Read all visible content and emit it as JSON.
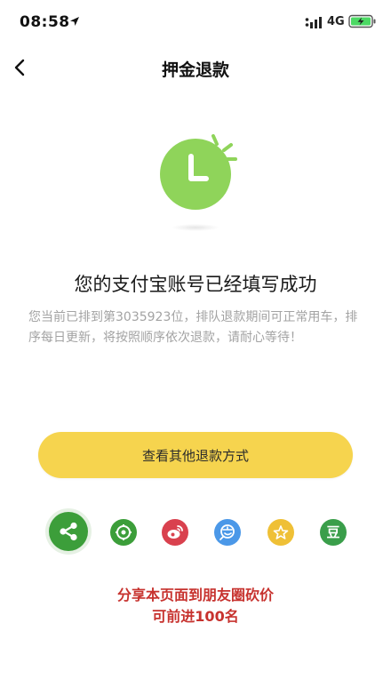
{
  "status_bar": {
    "time": "08:58",
    "network": "4G"
  },
  "nav": {
    "title": "押金退款"
  },
  "main": {
    "headline": "您的支付宝账号已经填写成功",
    "notice": "您当前已排到第3035923位，排队退款期间可正常用车，排序每日更新，将按照顺序依次退款，请耐心等待！",
    "primary_button": "查看其他退款方式"
  },
  "share": {
    "douban_glyph": "豆",
    "promo_line1": "分享本页面到朋友圈砍价",
    "promo_line2": "可前进100名"
  },
  "colors": {
    "accent_yellow": "#f6d44e",
    "clock_green": "#8fd45a",
    "share_green": "#3c9e3a",
    "weibo_red": "#d9414e",
    "alipay_blue": "#4b98e8",
    "star_yellow": "#efc036",
    "promo_red": "#c7322e"
  },
  "icons": [
    "location-arrow-icon",
    "signal-icon",
    "battery-charging-icon",
    "back-chevron-icon",
    "clock-icon",
    "share-icon",
    "wechat-moments-icon",
    "weibo-icon",
    "alipay-icon",
    "favorite-star-icon",
    "douban-icon"
  ]
}
